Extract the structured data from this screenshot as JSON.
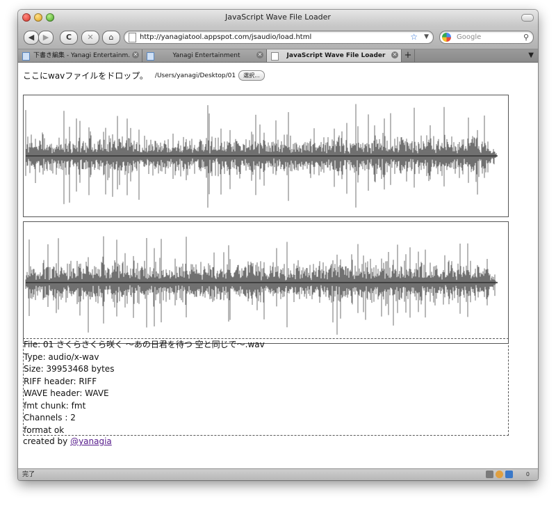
{
  "window": {
    "title": "JavaScript Wave File Loader"
  },
  "toolbar": {
    "back_label": "◀",
    "forward_label": "▶",
    "reload_label": "C",
    "stop_label": "✕",
    "home_label": "⌂",
    "url": "http://yanagiatool.appspot.com/jsaudio/load.html",
    "search_placeholder": "Google"
  },
  "tabs": [
    {
      "label": "下書き編集 - Yanagi Entertainm...",
      "active": false
    },
    {
      "label": "Yanagi Entertainment",
      "active": false
    },
    {
      "label": "JavaScript Wave File Loader",
      "active": true
    }
  ],
  "page": {
    "drop_label": "ここにwavファイルをドロップ。",
    "file_path": "/Users/yanagi/Desktop/01",
    "file_button": "選択...",
    "info": {
      "file": "File: 01 さくらさくら咲く 〜あの日君を待つ 空と同じで〜.wav",
      "type": "Type: audio/x-wav",
      "size": "Size: 39953468 bytes",
      "riff": "RIFF header: RIFF",
      "wave": "WAVE header: WAVE",
      "fmt": "fmt chunk: fmt",
      "channels": "Channels : 2",
      "format": "format ok"
    },
    "credit_prefix": "created by ",
    "credit_link": "@yanagia"
  },
  "status": {
    "text": "完了",
    "counter": "0"
  }
}
